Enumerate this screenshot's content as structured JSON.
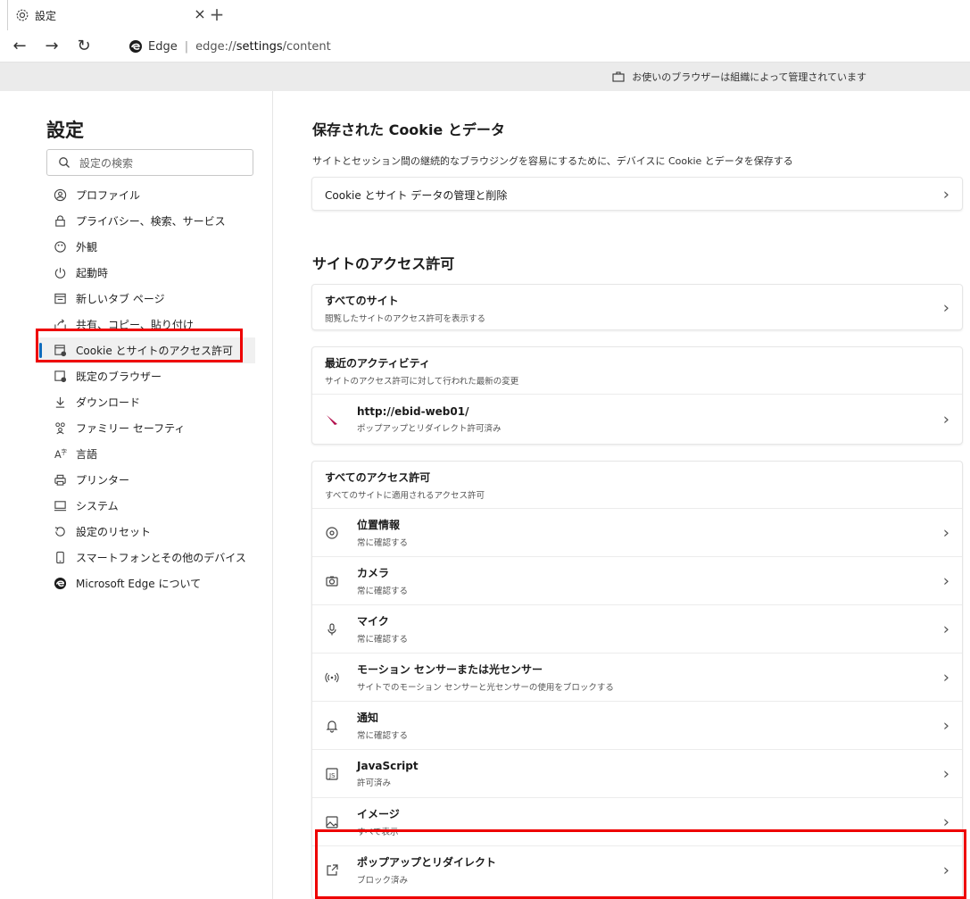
{
  "tab": {
    "title": "設定",
    "close_glyph": "×",
    "new_tab_glyph": "+"
  },
  "address": {
    "site_label": "Edge",
    "separator": "|",
    "url_prefix": "edge://",
    "url_bold": "settings",
    "url_suffix": "/content"
  },
  "managed": {
    "text": "お使いのブラウザーは組織によって管理されています"
  },
  "sidebar": {
    "title": "設定",
    "search_placeholder": "設定の検索",
    "items": [
      {
        "label": "プロファイル",
        "icon": "profile-icon"
      },
      {
        "label": "プライバシー、検索、サービス",
        "icon": "lock-icon"
      },
      {
        "label": "外観",
        "icon": "appearance-icon"
      },
      {
        "label": "起動時",
        "icon": "power-icon"
      },
      {
        "label": "新しいタブ ページ",
        "icon": "newtab-icon"
      },
      {
        "label": "共有、コピー、貼り付け",
        "icon": "share-icon"
      },
      {
        "label": "Cookie とサイトのアクセス許可",
        "icon": "cookie-permissions-icon",
        "active": true
      },
      {
        "label": "既定のブラウザー",
        "icon": "default-browser-icon"
      },
      {
        "label": "ダウンロード",
        "icon": "download-icon"
      },
      {
        "label": "ファミリー セーフティ",
        "icon": "family-icon"
      },
      {
        "label": "言語",
        "icon": "language-icon"
      },
      {
        "label": "プリンター",
        "icon": "printer-icon"
      },
      {
        "label": "システム",
        "icon": "system-icon"
      },
      {
        "label": "設定のリセット",
        "icon": "reset-icon"
      },
      {
        "label": "スマートフォンとその他のデバイス",
        "icon": "phone-icon"
      },
      {
        "label": "Microsoft Edge について",
        "icon": "edge-logo-icon"
      }
    ]
  },
  "main": {
    "cookies": {
      "heading": "保存された Cookie とデータ",
      "description": "サイトとセッション間の継続的なブラウジングを容易にするために、デバイスに Cookie とデータを保存する",
      "manage_label": "Cookie とサイト データの管理と削除"
    },
    "permissions": {
      "heading": "サイトのアクセス許可",
      "all_sites_title": "すべてのサイト",
      "all_sites_sub": "閲覧したサイトのアクセス許可を表示する",
      "recent_title": "最近のアクティビティ",
      "recent_sub": "サイトのアクセス許可に対して行われた最新の変更",
      "recent_site_url": "http://ebid-web01/",
      "recent_site_sub": "ポップアップとリダイレクト許可済み",
      "all_perms_title": "すべてのアクセス許可",
      "all_perms_sub": "すべてのサイトに適用されるアクセス許可",
      "items": [
        {
          "title": "位置情報",
          "sub": "常に確認する",
          "icon": "location-icon"
        },
        {
          "title": "カメラ",
          "sub": "常に確認する",
          "icon": "camera-icon"
        },
        {
          "title": "マイク",
          "sub": "常に確認する",
          "icon": "microphone-icon"
        },
        {
          "title": "モーション センサーまたは光センサー",
          "sub": "サイトでのモーション センサーと光センサーの使用をブロックする",
          "icon": "motion-sensor-icon"
        },
        {
          "title": "通知",
          "sub": "常に確認する",
          "icon": "bell-icon"
        },
        {
          "title": "JavaScript",
          "sub": "許可済み",
          "icon": "javascript-icon"
        },
        {
          "title": "イメージ",
          "sub": "すべて表示",
          "icon": "image-icon"
        },
        {
          "title": "ポップアップとリダイレクト",
          "sub": "ブロック済み",
          "icon": "popup-icon"
        }
      ]
    }
  },
  "colors": {
    "highlight_red": "#e00000",
    "active_accent": "#0f6cbd"
  }
}
